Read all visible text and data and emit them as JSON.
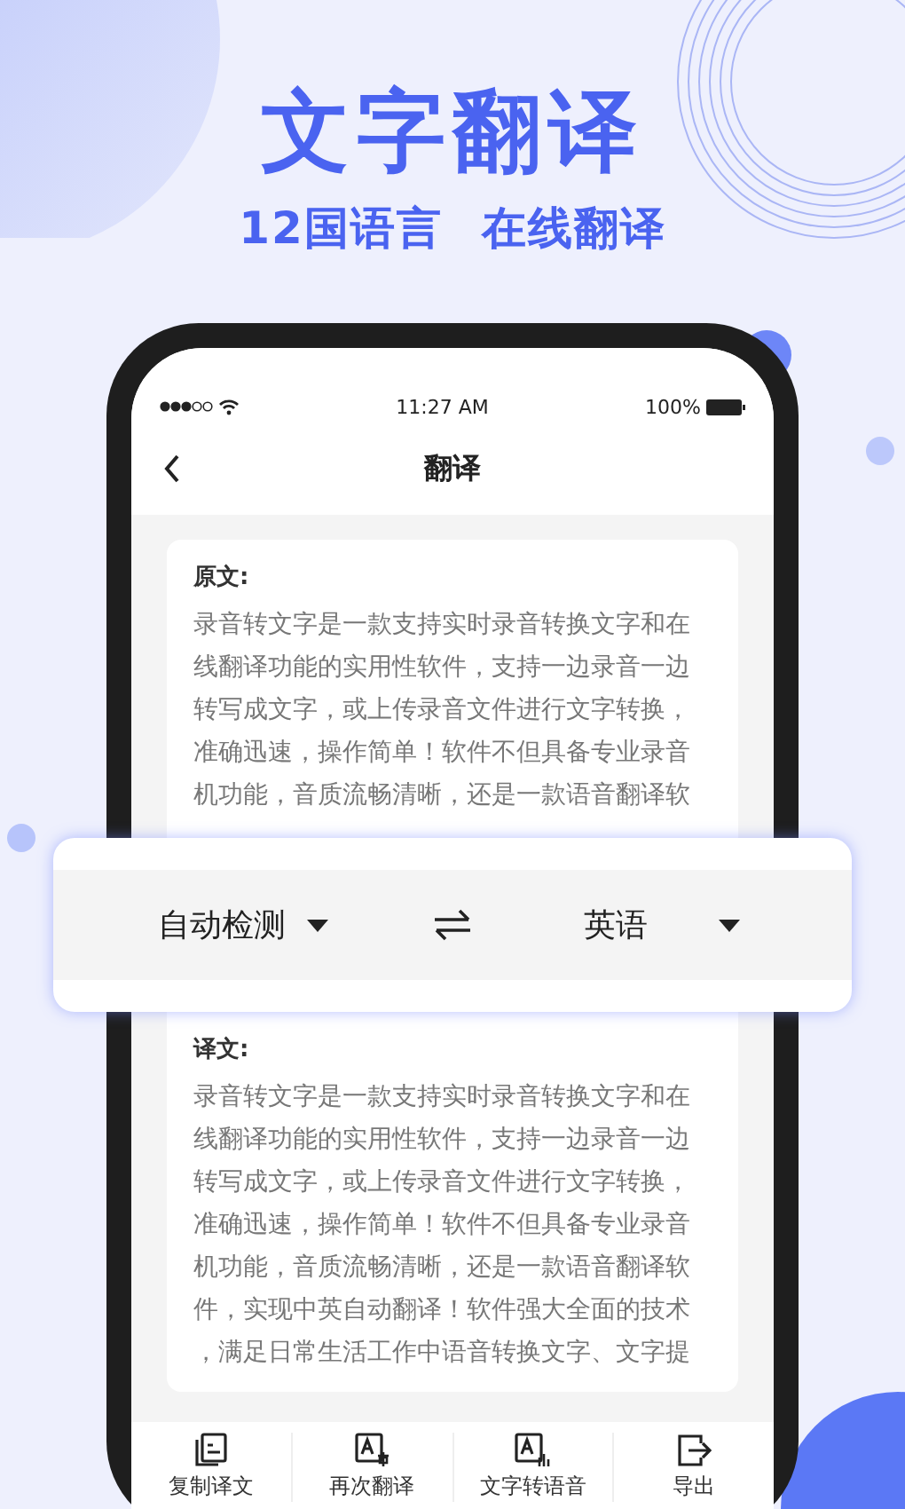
{
  "headline": "文字翻译",
  "taglines": [
    "12国语言",
    "在线翻译"
  ],
  "status_bar": {
    "time": "11:27 AM",
    "battery": "100%"
  },
  "nav": {
    "title": "翻译"
  },
  "source": {
    "label": "原文:",
    "text": "录音转文字是一款支持实时录音转换文字和在线翻译功能的实用性软件，支持一边录音一边转写成文字，或上传录音文件进行文字转换，准确迅速，操作简单！软件不但具备专业录音机功能，音质流畅清晰，还是一款语音翻译软"
  },
  "language_bar": {
    "from": "自动检测",
    "to": "英语"
  },
  "translation": {
    "label": "译文:",
    "text": "录音转文字是一款支持实时录音转换文字和在线翻译功能的实用性软件，支持一边录音一边转写成文字，或上传录音文件进行文字转换，准确迅速，操作简单！软件不但具备专业录音机功能，音质流畅清晰，还是一款语音翻译软件，实现中英自动翻译！软件强大全面的技术，满足日常生活工作中语音转换文字、文字提"
  },
  "toolbar": [
    {
      "kind": "copy",
      "label": "复制译文"
    },
    {
      "kind": "retranslate",
      "label": "再次翻译"
    },
    {
      "kind": "speak",
      "label": "文字转语音"
    },
    {
      "kind": "export",
      "label": "导出"
    }
  ]
}
